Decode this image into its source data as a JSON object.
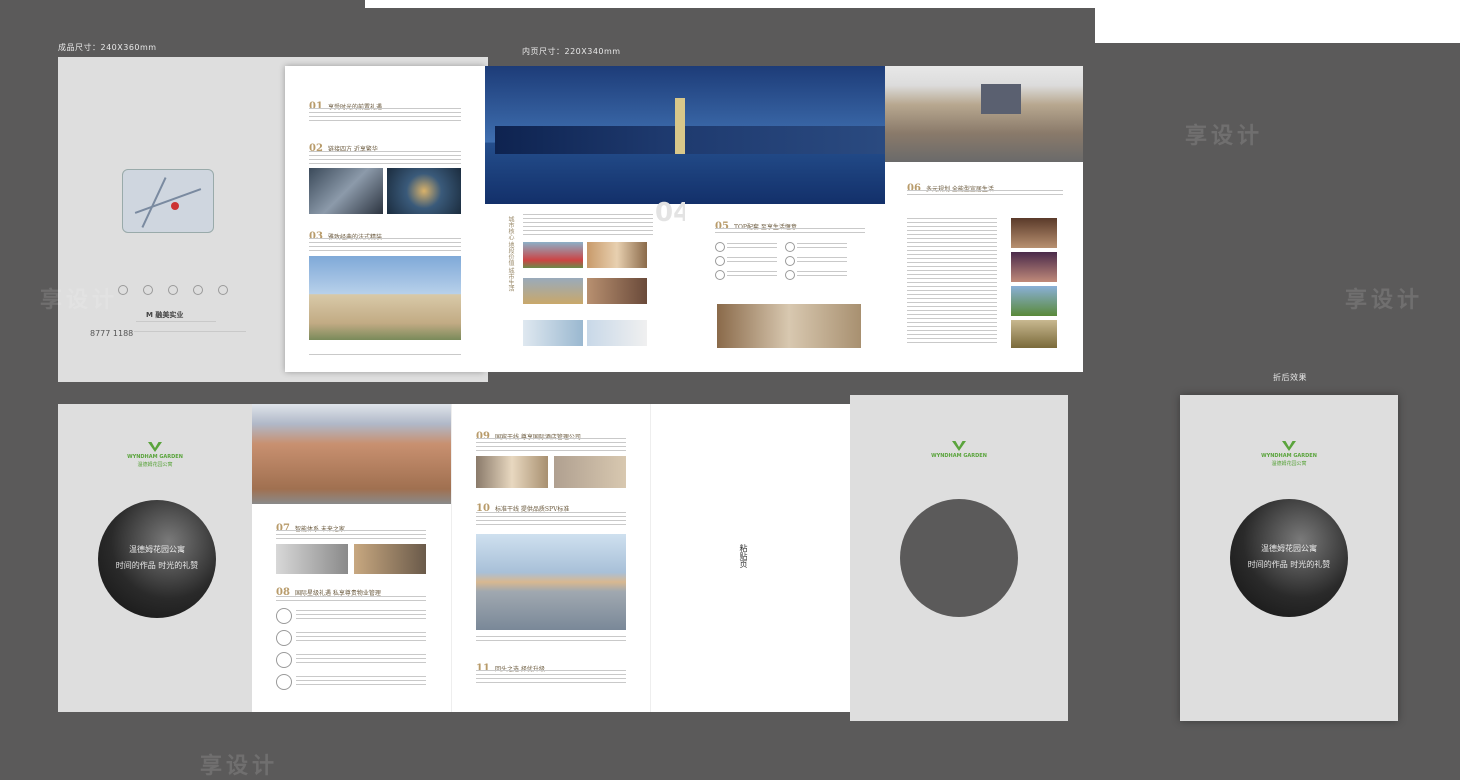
{
  "labels": {
    "finished_size": "成品尺寸：240X360mm",
    "inner_size": "内页尺寸：220X340mm",
    "folded_effect": "折后效果"
  },
  "brand": {
    "name_en": "WYNDHAM GARDEN",
    "name_cn": "温德姆花园公寓",
    "developer": "融美实业",
    "hotline": "8777 1188"
  },
  "slogan": {
    "line1": "温德姆花园公寓",
    "line2": "时间的作品 时光的礼赞"
  },
  "paste_page": "粘贴页",
  "sections": {
    "s01": {
      "num": "01",
      "title": "享受时光的前置礼遇"
    },
    "s02": {
      "num": "02",
      "title": "链接四方 近享繁华"
    },
    "s03": {
      "num": "03",
      "title": "雅致经典的法式精装"
    },
    "s05": {
      "num": "05",
      "title": "TOP配套 至享生活惬意"
    },
    "s06": {
      "num": "06",
      "title": "多元规划 全能型宜居生活"
    },
    "s07": {
      "num": "07",
      "title": "智能体系 未来之家"
    },
    "s08": {
      "num": "08",
      "title": "国际星级礼遇 私享尊贵物业管理"
    },
    "s09": {
      "num": "09",
      "title": "国宾干线 尊享国际酒店管理公司"
    },
    "s10": {
      "num": "10",
      "title": "标准干线 提供品质SPV标准"
    },
    "s11": {
      "num": "11",
      "title": "回头之选 择优升级"
    }
  },
  "big_num": "04",
  "vertical_text": "城市核心 地段价值 城市生活",
  "colors": {
    "bg": "#5b5a5a",
    "accent_gold": "#b89b6a",
    "brand_green": "#5aa43c"
  },
  "watermark": "享设计"
}
